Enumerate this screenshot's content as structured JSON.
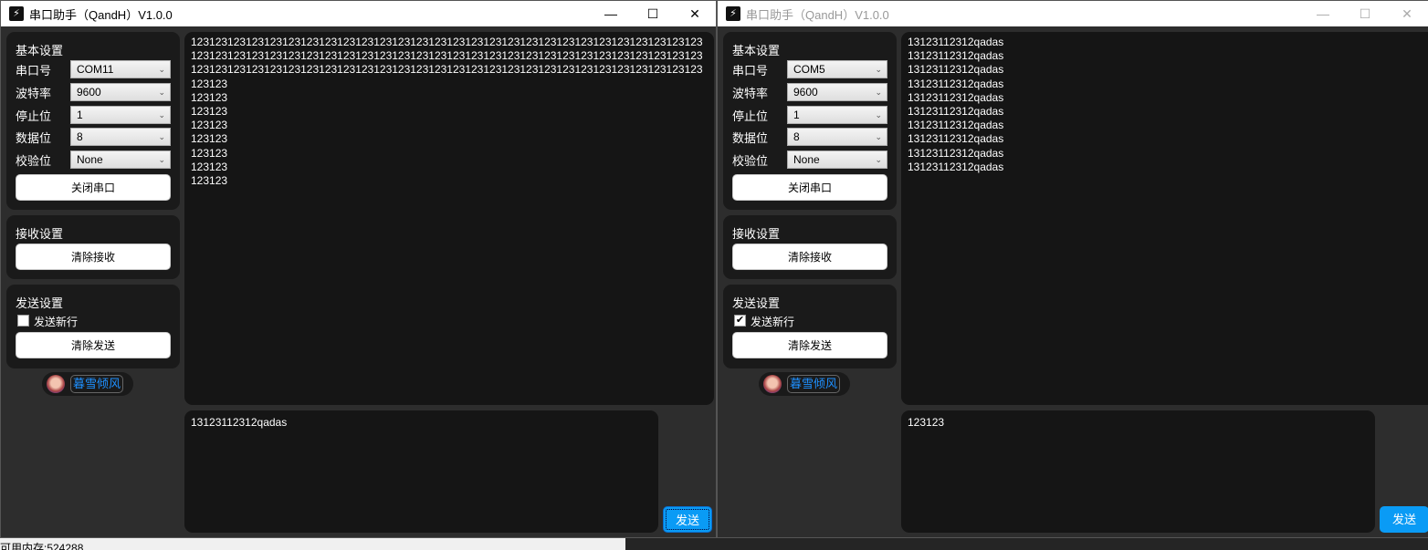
{
  "windows": [
    {
      "title": "串口助手（QandH）V1.0.0",
      "basic": {
        "heading": "基本设置",
        "port_label": "串口号",
        "port": "COM11",
        "baud_label": "波特率",
        "baud": "9600",
        "stop_label": "停止位",
        "stop": "1",
        "data_label": "数据位",
        "data": "8",
        "parity_label": "校验位",
        "parity": "None",
        "toggle_button": "关闭串口"
      },
      "receive": {
        "heading": "接收设置",
        "clear_button": "清除接收"
      },
      "send": {
        "heading": "发送设置",
        "newline_label": "发送新行",
        "newline_checked": false,
        "clear_button": "清除发送"
      },
      "author": "暮雪倾风",
      "receive_text": "123123123123123123123123123123123123123123123123123123123123123123123123123123123123123123123123123123123123123123123123123123123123123123123123123123123123123123123123123123123123123123123123123123123123123123123123123123123123123123123123123123123123123123\n123123\n123123\n123123\n123123\n123123\n123123\n123123",
      "send_text": "13123112312qadas",
      "send_button": "发送"
    },
    {
      "title": "串口助手（QandH）V1.0.0",
      "basic": {
        "heading": "基本设置",
        "port_label": "串口号",
        "port": "COM5",
        "baud_label": "波特率",
        "baud": "9600",
        "stop_label": "停止位",
        "stop": "1",
        "data_label": "数据位",
        "data": "8",
        "parity_label": "校验位",
        "parity": "None",
        "toggle_button": "关闭串口"
      },
      "receive": {
        "heading": "接收设置",
        "clear_button": "清除接收"
      },
      "send": {
        "heading": "发送设置",
        "newline_label": "发送新行",
        "newline_checked": true,
        "clear_button": "清除发送"
      },
      "author": "暮雪倾风",
      "receive_text": "13123112312qadas\n13123112312qadas\n13123112312qadas\n13123112312qadas\n13123112312qadas\n13123112312qadas\n13123112312qadas\n13123112312qadas\n13123112312qadas\n13123112312qadas",
      "send_text": "123123",
      "send_button": "发送"
    }
  ],
  "window_controls": {
    "minimize": "—",
    "maximize": "☐",
    "close": "✕"
  },
  "status_text": "可用内存:524288"
}
